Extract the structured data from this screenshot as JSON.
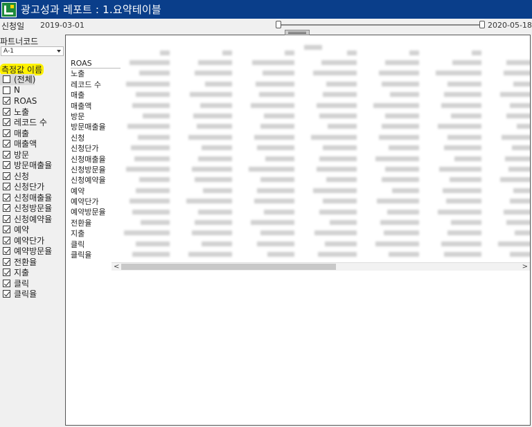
{
  "window": {
    "title": "광고성과 레포트 : 1.요약테이블"
  },
  "date_filter": {
    "label": "신청일",
    "start": "2019-03-01",
    "end": "2020-05-18"
  },
  "partner": {
    "label": "파트너코드",
    "selected": "A-1"
  },
  "measures": {
    "label": "측정값 이름",
    "items": [
      {
        "label": "(전체)",
        "checked": false
      },
      {
        "label": "N",
        "checked": false
      },
      {
        "label": "ROAS",
        "checked": true
      },
      {
        "label": "노출",
        "checked": true
      },
      {
        "label": "레코드 수",
        "checked": true
      },
      {
        "label": "매출",
        "checked": true
      },
      {
        "label": "매출액",
        "checked": true
      },
      {
        "label": "방문",
        "checked": true
      },
      {
        "label": "방문매출율",
        "checked": true
      },
      {
        "label": "신청",
        "checked": true
      },
      {
        "label": "신청단가",
        "checked": true
      },
      {
        "label": "신청매출율",
        "checked": true
      },
      {
        "label": "신청방문율",
        "checked": true
      },
      {
        "label": "신청예약율",
        "checked": true
      },
      {
        "label": "예약",
        "checked": true
      },
      {
        "label": "예약단가",
        "checked": true
      },
      {
        "label": "예약방문율",
        "checked": true
      },
      {
        "label": "전환율",
        "checked": true
      },
      {
        "label": "지출",
        "checked": true
      },
      {
        "label": "클릭",
        "checked": true
      },
      {
        "label": "클릭율",
        "checked": true
      }
    ]
  },
  "table": {
    "rows": [
      "ROAS",
      "노출",
      "레코드 수",
      "매출",
      "매출액",
      "방문",
      "방문매출율",
      "신청",
      "신청단가",
      "신청매출율",
      "신청방문율",
      "신청예약율",
      "예약",
      "예약단가",
      "예약방문율",
      "전환율",
      "지출",
      "클릭",
      "클릭율"
    ]
  },
  "scrollbar": {
    "left_arrow": "<",
    "right_arrow": ">"
  }
}
